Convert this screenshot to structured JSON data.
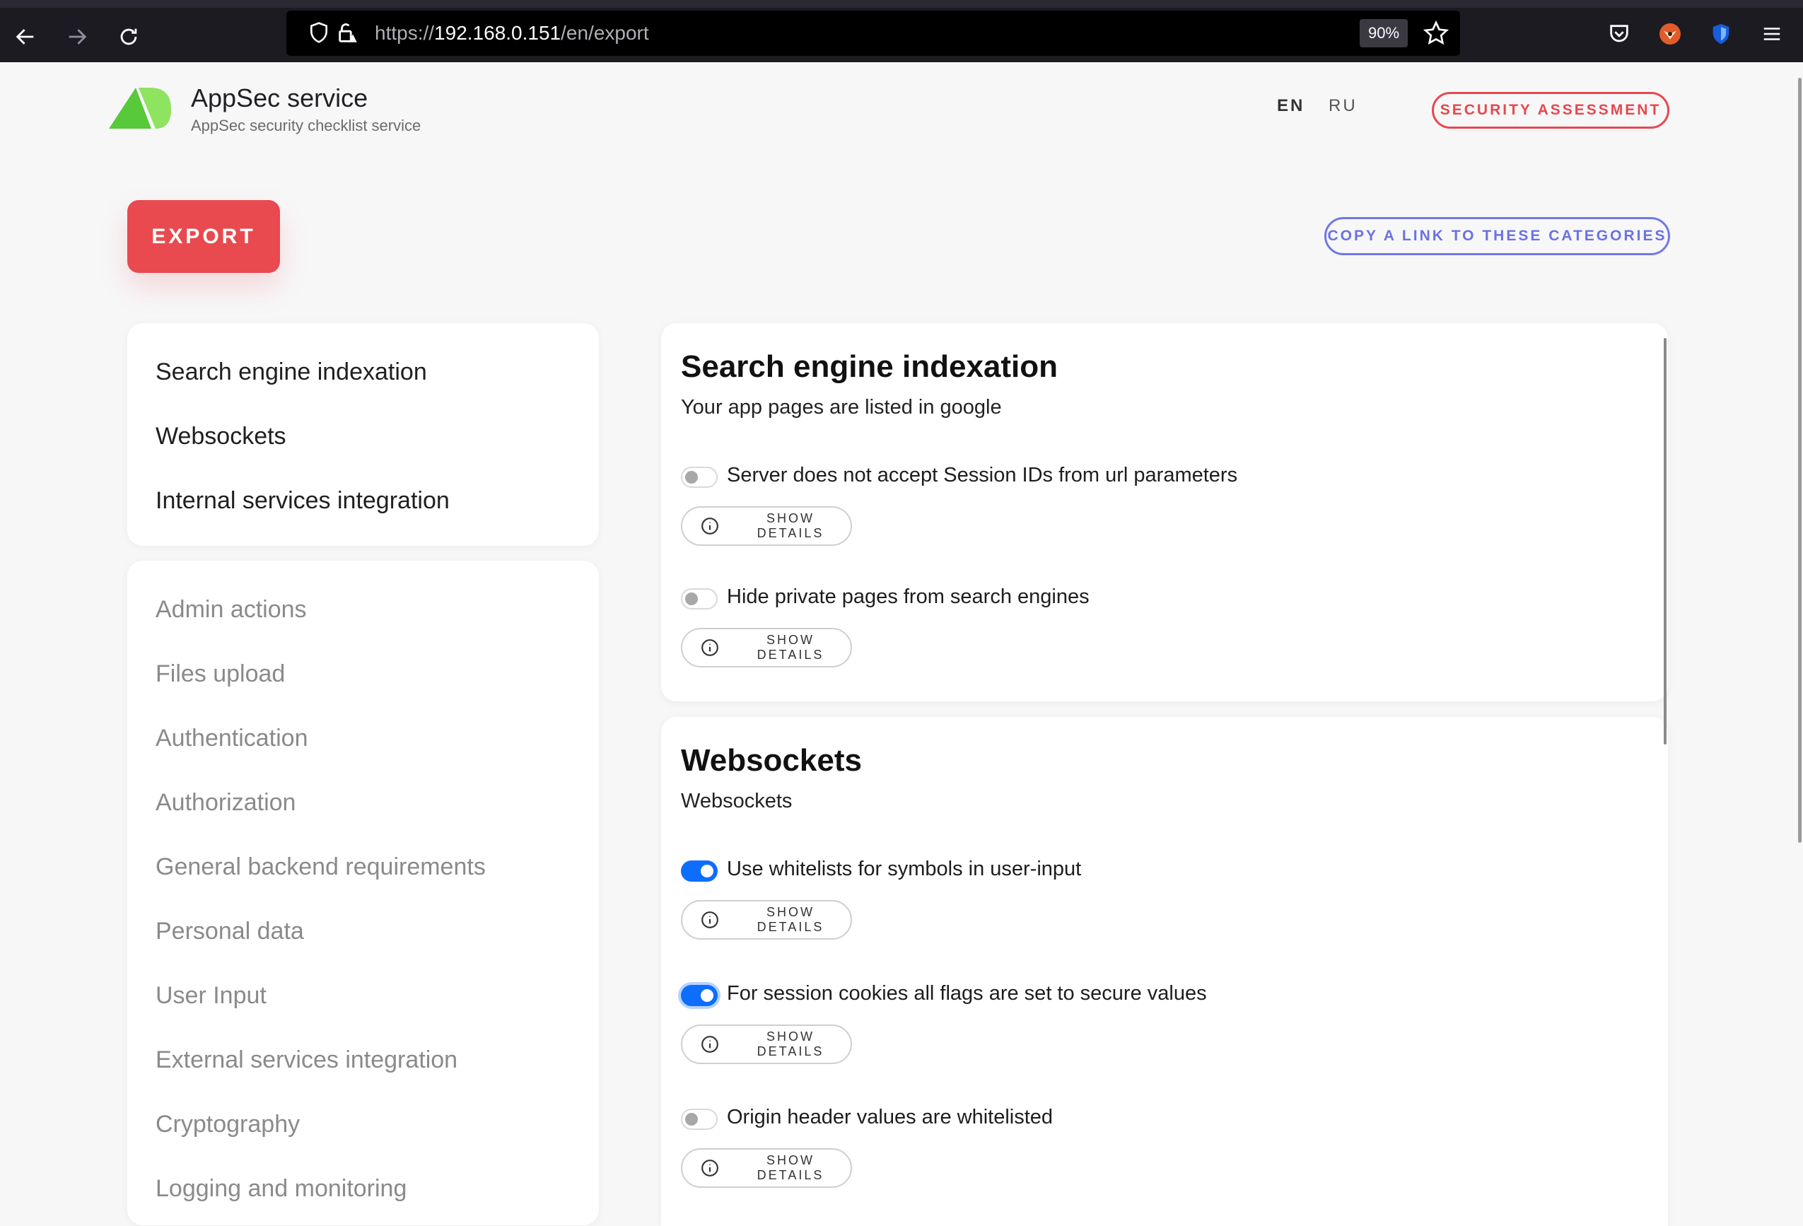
{
  "browser": {
    "url_scheme": "https://",
    "url_host": "192.168.0.151",
    "url_path": "/en/export",
    "zoom": "90%"
  },
  "header": {
    "title": "AppSec service",
    "subtitle": "AppSec security checklist service",
    "lang_en": "EN",
    "lang_ru": "RU",
    "assessment_button": "SECURITY ASSESSMENT"
  },
  "actions": {
    "export_button": "EXPORT",
    "copy_link_button": "COPY A LINK TO THESE CATEGORIES"
  },
  "selected_categories": [
    "Search engine indexation",
    "Websockets",
    "Internal services integration"
  ],
  "other_categories": [
    "Admin actions",
    "Files upload",
    "Authentication",
    "Authorization",
    "General backend requirements",
    "Personal data",
    "User Input",
    "External services integration",
    "Cryptography",
    "Logging and monitoring"
  ],
  "sections": [
    {
      "title": "Search engine indexation",
      "description": "Your app pages are listed in google",
      "items": [
        {
          "label": "Server does not accept Session IDs from url parameters",
          "checked": false,
          "details": "SHOW DETAILS"
        },
        {
          "label": "Hide private pages from search engines",
          "checked": false,
          "details": "SHOW DETAILS"
        }
      ]
    },
    {
      "title": "Websockets",
      "description": "Websockets",
      "items": [
        {
          "label": "Use whitelists for symbols in user-input",
          "checked": true,
          "details": "SHOW DETAILS"
        },
        {
          "label": "For session cookies all flags are set to secure values",
          "checked": true,
          "details": "SHOW DETAILS"
        },
        {
          "label": "Origin header values are whitelisted",
          "checked": false,
          "details": "SHOW DETAILS"
        }
      ]
    }
  ],
  "colors": {
    "accent_red": "#e84a4f",
    "accent_blue": "#0d6efd",
    "accent_violet": "#6b72e2",
    "logo_green": "#5ecf3b"
  }
}
